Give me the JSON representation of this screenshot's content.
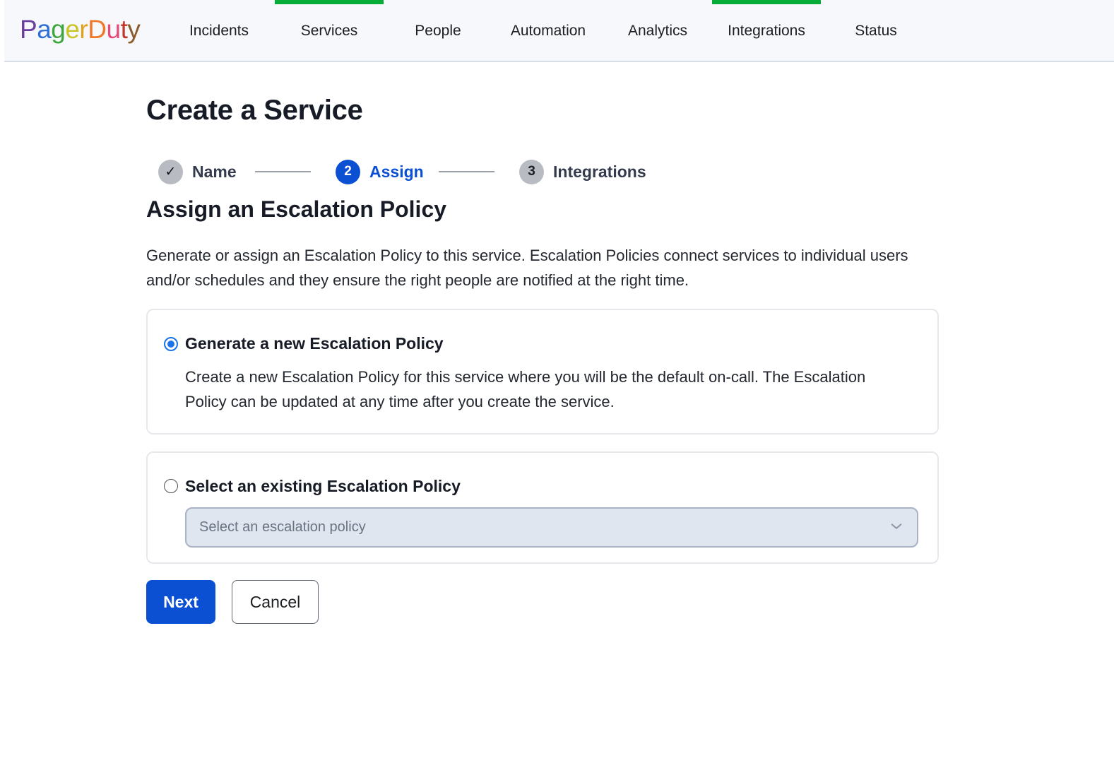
{
  "brand": {
    "name": "PagerDuty",
    "letter_colors": [
      "#6b3fa0",
      "#2f6fd6",
      "#3ea63e",
      "#c9c42a",
      "#e0a21b",
      "#f0782a",
      "#e64a7a",
      "#c0392b",
      "#8a5a2b",
      "#1a1a1a"
    ]
  },
  "nav": {
    "items": [
      {
        "label": "Incidents",
        "highlight": false
      },
      {
        "label": "Services",
        "highlight": true
      },
      {
        "label": "People",
        "highlight": false
      },
      {
        "label": "Automation",
        "highlight": false
      },
      {
        "label": "Analytics",
        "highlight": false
      },
      {
        "label": "Integrations",
        "highlight": true
      },
      {
        "label": "Status",
        "highlight": false
      }
    ],
    "highlight_color": "#06ac38"
  },
  "page": {
    "title": "Create a Service"
  },
  "stepper": {
    "steps": [
      {
        "marker": "✓",
        "label": "Name",
        "state": "done"
      },
      {
        "marker": "2",
        "label": "Assign",
        "state": "active"
      },
      {
        "marker": "3",
        "label": "Integrations",
        "state": "pending"
      }
    ]
  },
  "section": {
    "title": "Assign an Escalation Policy",
    "description": "Generate or assign an Escalation Policy to this service. Escalation Policies connect services to individual users and/or schedules and they ensure the right people are notified at the right time."
  },
  "options": {
    "generate": {
      "label": "Generate a new Escalation Policy",
      "description": "Create a new Escalation Policy for this service where you will be the default on-call. The Escalation Policy can be updated at any time after you create the service.",
      "selected": true
    },
    "existing": {
      "label": "Select an existing Escalation Policy",
      "selected": false,
      "select_placeholder": "Select an escalation policy",
      "select_value": ""
    }
  },
  "actions": {
    "next_label": "Next",
    "cancel_label": "Cancel",
    "primary_color": "#0b4fd3"
  }
}
